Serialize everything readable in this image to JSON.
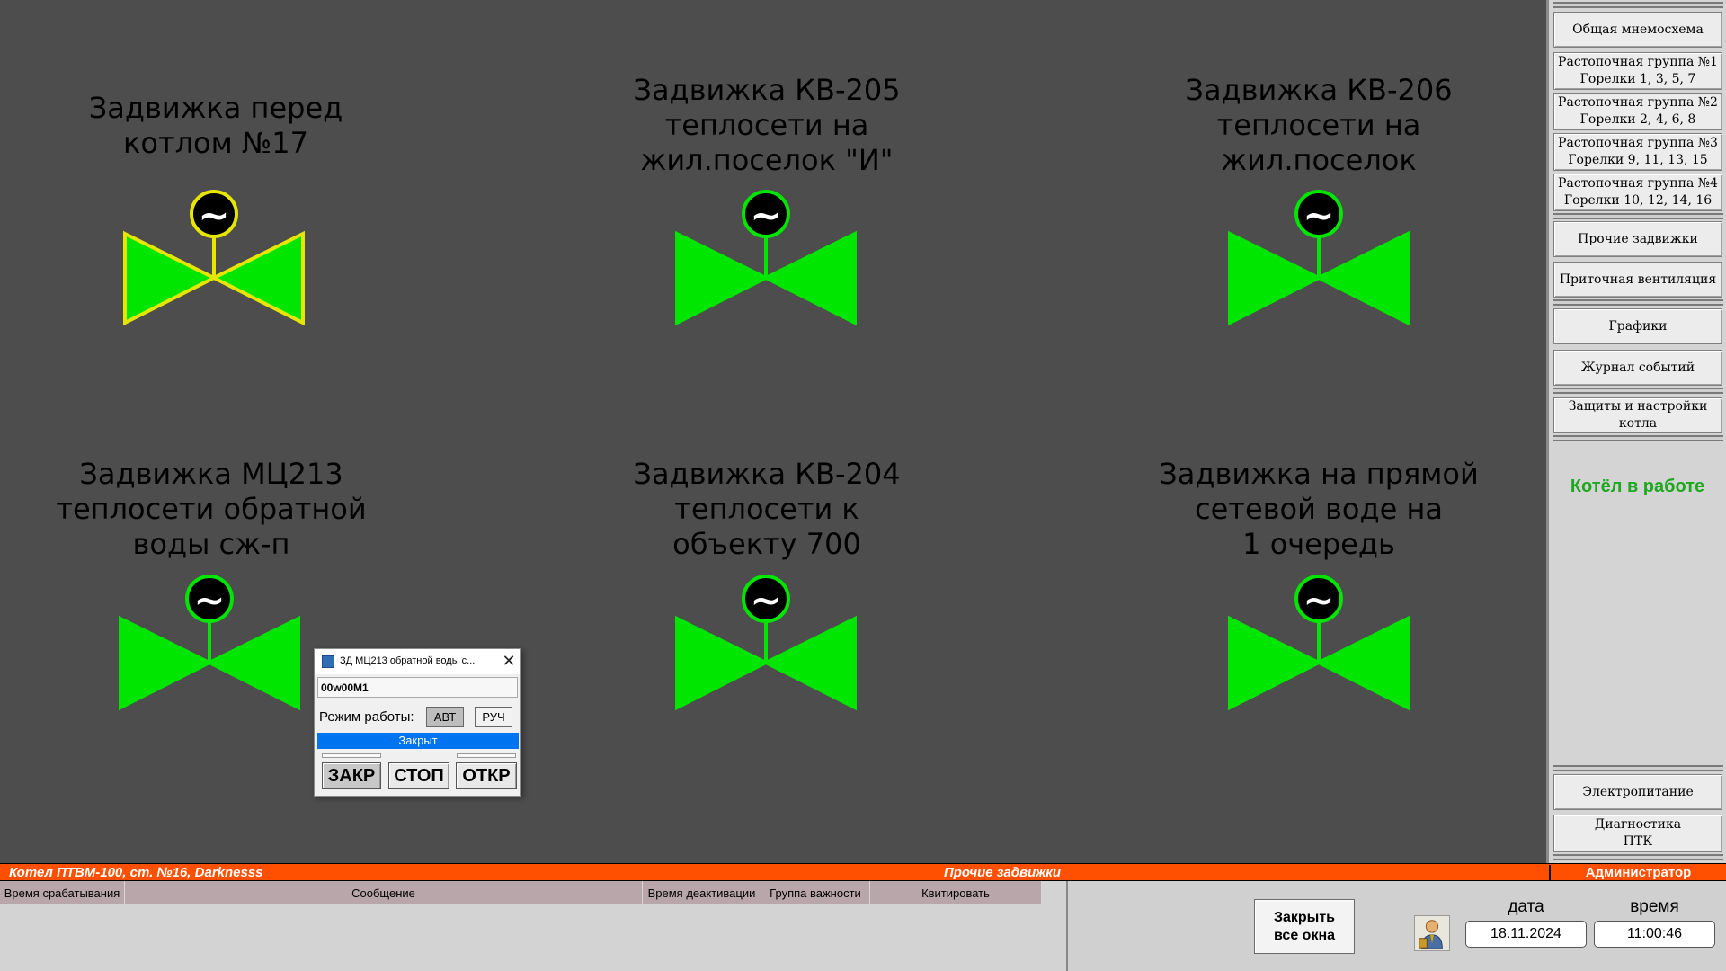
{
  "valves": [
    {
      "title": [
        "Задвижка перед",
        "котлом №17"
      ],
      "actuator_symbol": "~",
      "state": "open",
      "outline_color": "#e6e600",
      "fill_color": "#00e600"
    },
    {
      "title": [
        "Задвижка КВ-205",
        "теплосети на",
        "жил.поселок \"И\""
      ],
      "actuator_symbol": "~",
      "state": "open",
      "outline_color": "#00e600",
      "fill_color": "#00e600"
    },
    {
      "title": [
        "Задвижка КВ-206",
        "теплосети на",
        "жил.поселок"
      ],
      "actuator_symbol": "~",
      "state": "open",
      "outline_color": "#00e600",
      "fill_color": "#00e600"
    },
    {
      "title": [
        "Задвижка МЦ213",
        "теплосети обратной",
        "воды сж-п"
      ],
      "actuator_symbol": "~",
      "state": "open",
      "outline_color": "#00e600",
      "fill_color": "#00e600"
    },
    {
      "title": [
        "Задвижка КВ-204",
        "теплосети к",
        "объекту 700"
      ],
      "actuator_symbol": "~",
      "state": "open",
      "outline_color": "#00e600",
      "fill_color": "#00e600"
    },
    {
      "title": [
        "Задвижка на прямой",
        "сетевой воде на",
        "1 очередь"
      ],
      "actuator_symbol": "~",
      "state": "open",
      "outline_color": "#00e600",
      "fill_color": "#00e600"
    }
  ],
  "nav": {
    "overview": "Общая мнемосхема",
    "group1": [
      "Растопочная группа №1",
      "Горелки 1, 3, 5, 7"
    ],
    "group2": [
      "Растопочная группа №2",
      "Горелки 2, 4, 6, 8"
    ],
    "group3": [
      "Растопочная группа №3",
      "Горелки 9, 11, 13, 15"
    ],
    "group4": [
      "Растопочная группа №4",
      "Горелки 10, 12, 14, 16"
    ],
    "other_valves": "Прочие задвижки",
    "ventilation": "Приточная вентиляция",
    "charts": "Графики",
    "event_log": "Журнал событий",
    "protections": "Защиты и настройки котла",
    "power": "Электропитание",
    "diagnostics": [
      "Диагностика",
      "ПТК"
    ]
  },
  "boiler_status": "Котёл в работе",
  "status_bar": {
    "left": "Котел ПТВМ-100, ст. №16, Darknesss",
    "center": "Прочие задвижки",
    "user": "Администратор"
  },
  "events_table": {
    "columns": [
      "Время срабатывания",
      "Сообщение",
      "Время деактивации",
      "Группа важности",
      "Квитировать"
    ]
  },
  "close_all": [
    "Закрыть",
    "все окна"
  ],
  "datetime": {
    "date_label": "дата",
    "time_label": "время",
    "date": "18.11.2024",
    "time": "11:00:46"
  },
  "popup": {
    "title": "ЗД МЦ213 обратной воды с...",
    "close": "✕",
    "tag": "00w00M1",
    "mode_label": "Режим работы:",
    "mode_auto": "АВТ",
    "mode_manual": "РУЧ",
    "state": "Закрыт",
    "btn_close": "ЗАКР",
    "btn_stop": "СТОП",
    "btn_open": "ОТКР"
  },
  "colors": {
    "background": "#4d4d4d",
    "valve_green": "#00e600",
    "valve_yellow": "#e6e600",
    "status_orange": "#ff4f00",
    "state_blue": "#0074f0",
    "boiler_status_green": "#1fa81f"
  }
}
